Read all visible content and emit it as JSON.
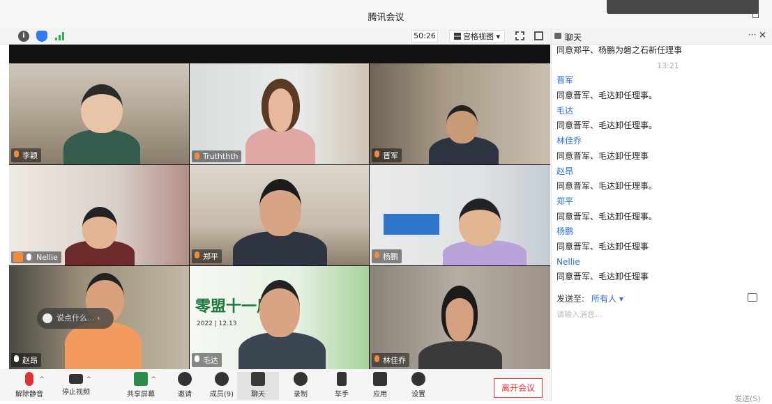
{
  "window": {
    "title": "腾讯会议"
  },
  "top_toolbar": {
    "timer": "50:26",
    "view_label": "宫格视图 ▾",
    "icons": [
      "info-icon",
      "shield-icon",
      "signal-icon",
      "fullscreen-icon",
      "layout-icon"
    ]
  },
  "participants": [
    {
      "name": "李颖"
    },
    {
      "name": "Truththth"
    },
    {
      "name": "晋军"
    },
    {
      "name": "Nellie"
    },
    {
      "name": "郑平"
    },
    {
      "name": "杨鹏"
    },
    {
      "name": "赵昂"
    },
    {
      "name": "毛达"
    },
    {
      "name": "林佳乔"
    }
  ],
  "tile_overlay": {
    "chat_placeholder": "说点什么...",
    "event_banner_title": "零盟十一周",
    "event_banner_date": "2022 | 12.13"
  },
  "bottom_toolbar": {
    "items": [
      {
        "label": "解除静音"
      },
      {
        "label": "停止视频"
      },
      {
        "label": "共享屏幕"
      },
      {
        "label": "邀请"
      },
      {
        "label": "成员(9)"
      },
      {
        "label": "聊天"
      },
      {
        "label": "录制"
      },
      {
        "label": "举手"
      },
      {
        "label": "应用"
      },
      {
        "label": "设置"
      }
    ],
    "leave_label": "离开会议"
  },
  "chat": {
    "title": "聊天",
    "more": "···",
    "close": "×",
    "messages": [
      {
        "text": "同意郑平、杨鹏为磐之石新任理事",
        "kind": "text"
      },
      {
        "text": "13:21",
        "kind": "time"
      },
      {
        "text": "晋军",
        "kind": "sender"
      },
      {
        "text": "同意晋军、毛达卸任理事。",
        "kind": "text"
      },
      {
        "text": "毛达",
        "kind": "sender"
      },
      {
        "text": "同意晋军、毛达卸任理事。",
        "kind": "text"
      },
      {
        "text": "林佳乔",
        "kind": "sender"
      },
      {
        "text": "同意晋军、毛达卸任理事",
        "kind": "text"
      },
      {
        "text": "赵昂",
        "kind": "sender"
      },
      {
        "text": "同意晋军、毛达卸任理事。",
        "kind": "text"
      },
      {
        "text": "郑平",
        "kind": "sender"
      },
      {
        "text": "同意晋军、毛达卸任理事。",
        "kind": "text"
      },
      {
        "text": "杨鹏",
        "kind": "sender"
      },
      {
        "text": "同意晋军、毛达卸任理事",
        "kind": "text"
      },
      {
        "text": "Nellie",
        "kind": "sender"
      },
      {
        "text": "同意晋军、毛达卸任理事",
        "kind": "text"
      }
    ],
    "send_to_label": "发送至:",
    "send_to_target": "所有人 ▾",
    "input_placeholder": "请输入消息...",
    "send_button": "发送(S)"
  },
  "colors": {
    "accent": "#2b6fd6",
    "leave": "#ee3333",
    "mic_active": "#f08a3c"
  }
}
